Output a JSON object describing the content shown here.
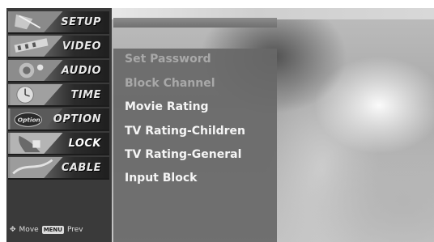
{
  "menu": {
    "tabs": [
      {
        "label": "SETUP",
        "icon": "setup-icon"
      },
      {
        "label": "VIDEO",
        "icon": "video-icon"
      },
      {
        "label": "AUDIO",
        "icon": "audio-icon"
      },
      {
        "label": "TIME",
        "icon": "time-icon"
      },
      {
        "label": "OPTION",
        "icon": "option-icon"
      },
      {
        "label": "LOCK",
        "icon": "lock-icon"
      },
      {
        "label": "CABLE",
        "icon": "cable-icon"
      }
    ],
    "active_tab": "LOCK"
  },
  "footer": {
    "move_label": "Move",
    "prev_key": "MENU",
    "prev_label": "Prev"
  },
  "submenu": {
    "items": [
      {
        "label": "Set Password",
        "enabled": false
      },
      {
        "label": "Block Channel",
        "enabled": false
      },
      {
        "label": "Movie Rating",
        "enabled": true
      },
      {
        "label": "TV Rating-Children",
        "enabled": true
      },
      {
        "label": "TV Rating-General",
        "enabled": true
      },
      {
        "label": "Input Block",
        "enabled": true
      }
    ]
  },
  "colors": {
    "menu_bg": "#3a3a3a",
    "submenu_bg": "#686868",
    "text_enabled": "#f5f5f5",
    "text_disabled": "#a8a8a8"
  }
}
